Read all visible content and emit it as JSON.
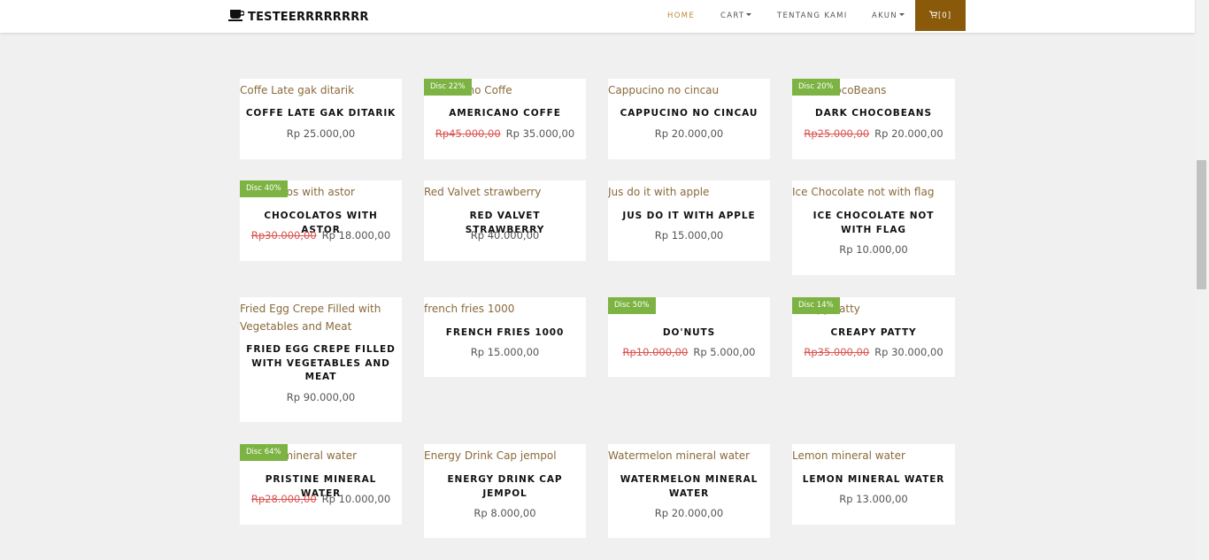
{
  "brand": {
    "name": "TESTEERRRRRRRR",
    "icon": "coffee-cup-icon"
  },
  "nav": {
    "home": "HOME",
    "cart": "CART",
    "about": "TENTANG KAMI",
    "account": "AKUN",
    "cart_count": "[0]"
  },
  "colors": {
    "accent": "#c48a3f",
    "cart_bg": "#8a5a0a",
    "badge": "#7cb342",
    "strike": "#d9534f"
  },
  "products": [
    {
      "alt": "Coffe Late gak ditarik",
      "name": "COFFE LATE GAK DITARIK",
      "price": "Rp 25.000,00"
    },
    {
      "alt": "Americano Coffe",
      "name": "AMERICANO COFFE",
      "badge": "Disc 22%",
      "old_price": "Rp45.000,00",
      "price": "Rp 35.000,00"
    },
    {
      "alt": "Cappucino no cincau",
      "name": "CAPPUCINO NO CINCAU",
      "price": "Rp 20.000,00"
    },
    {
      "alt": "Dark ChocoBeans",
      "name": "DARK CHOCOBEANS",
      "badge": "Disc 20%",
      "old_price": "Rp25.000,00",
      "price": "Rp 20.000,00"
    },
    {
      "alt": "Chocolatos with astor",
      "name": "CHOCOLATOS WITH ASTOR",
      "badge": "Disc 40%",
      "old_price": "Rp30.000,00",
      "price": "Rp 18.000,00"
    },
    {
      "alt": "Red Valvet strawberry",
      "name": "RED VALVET STRAWBERRY",
      "price": "Rp 40.000,00"
    },
    {
      "alt": "Jus do it with apple",
      "name": "JUS DO IT WITH APPLE",
      "price": "Rp 15.000,00"
    },
    {
      "alt": "Ice Chocolate not with flag",
      "name": "ICE CHOCOLATE NOT WITH FLAG",
      "price": "Rp 10.000,00"
    },
    {
      "alt": "Fried Egg Crepe Filled with Vegetables and Meat",
      "name": "FRIED EGG CREPE FILLED WITH VEGETABLES AND MEAT",
      "price": "Rp 90.000,00"
    },
    {
      "alt": "french fries 1000",
      "name": "FRENCH FRIES 1000",
      "price": "Rp 15.000,00"
    },
    {
      "alt": "Do'nuts",
      "name": "DO'NUTS",
      "badge": "Disc 50%",
      "old_price": "Rp10.000,00",
      "price": "Rp 5.000,00"
    },
    {
      "alt": "Creapy Patty",
      "name": "CREAPY PATTY",
      "badge": "Disc 14%",
      "old_price": "Rp35.000,00",
      "price": "Rp 30.000,00"
    },
    {
      "alt": "Pristine mineral water",
      "name": "PRISTINE MINERAL WATER",
      "badge": "Disc 64%",
      "old_price": "Rp28.000,00",
      "price": "Rp 10.000,00"
    },
    {
      "alt": "Energy Drink Cap jempol",
      "name": "ENERGY DRINK CAP JEMPOL",
      "price": "Rp 8.000,00"
    },
    {
      "alt": "Watermelon mineral water",
      "name": "WATERMELON MINERAL WATER",
      "price": "Rp 20.000,00"
    },
    {
      "alt": "Lemon mineral water",
      "name": "LEMON MINERAL WATER",
      "price": "Rp 13.000,00"
    }
  ]
}
